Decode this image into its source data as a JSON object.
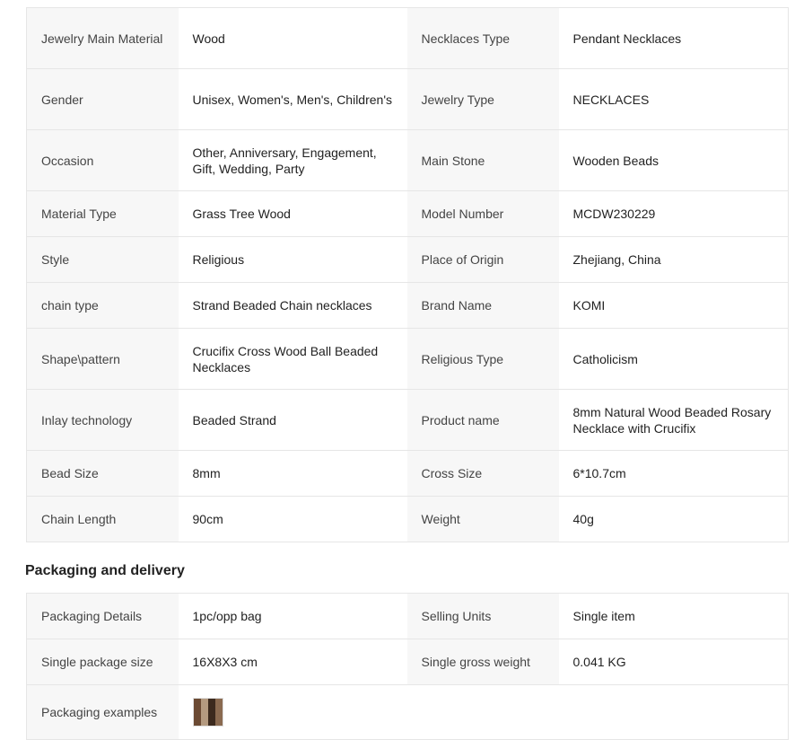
{
  "attributes": {
    "rows": [
      [
        {
          "key": "Jewelry Main Material",
          "value": "Wood"
        },
        {
          "key": "Necklaces Type",
          "value": "Pendant Necklaces"
        }
      ],
      [
        {
          "key": "Gender",
          "value": "Unisex, Women's, Men's, Children's"
        },
        {
          "key": "Jewelry Type",
          "value": "NECKLACES"
        }
      ],
      [
        {
          "key": "Occasion",
          "value": "Other, Anniversary, Engagement, Gift, Wedding, Party"
        },
        {
          "key": "Main Stone",
          "value": "Wooden Beads"
        }
      ],
      [
        {
          "key": "Material Type",
          "value": "Grass Tree Wood"
        },
        {
          "key": "Model Number",
          "value": "MCDW230229"
        }
      ],
      [
        {
          "key": "Style",
          "value": "Religious"
        },
        {
          "key": "Place of Origin",
          "value": "Zhejiang, China"
        }
      ],
      [
        {
          "key": "chain type",
          "value": "Strand Beaded Chain necklaces"
        },
        {
          "key": "Brand Name",
          "value": "KOMI"
        }
      ],
      [
        {
          "key": "Shape\\pattern",
          "value": "Crucifix Cross Wood Ball Beaded Necklaces"
        },
        {
          "key": "Religious Type",
          "value": "Catholicism"
        }
      ],
      [
        {
          "key": "Inlay technology",
          "value": "Beaded Strand"
        },
        {
          "key": "Product name",
          "value": "8mm Natural Wood Beaded Rosary Necklace with Crucifix"
        }
      ],
      [
        {
          "key": "Bead Size",
          "value": "8mm"
        },
        {
          "key": "Cross Size",
          "value": "6*10.7cm"
        }
      ],
      [
        {
          "key": "Chain Length",
          "value": "90cm"
        },
        {
          "key": "Weight",
          "value": "40g"
        }
      ]
    ]
  },
  "packaging": {
    "title": "Packaging and delivery",
    "rows": [
      [
        {
          "key": "Packaging Details",
          "value": "1pc/opp bag"
        },
        {
          "key": "Selling Units",
          "value": "Single item"
        }
      ],
      [
        {
          "key": "Single package size",
          "value": "16X8X3 cm"
        },
        {
          "key": "Single gross weight",
          "value": "0.041 KG"
        }
      ]
    ],
    "examples_label": "Packaging examples"
  }
}
